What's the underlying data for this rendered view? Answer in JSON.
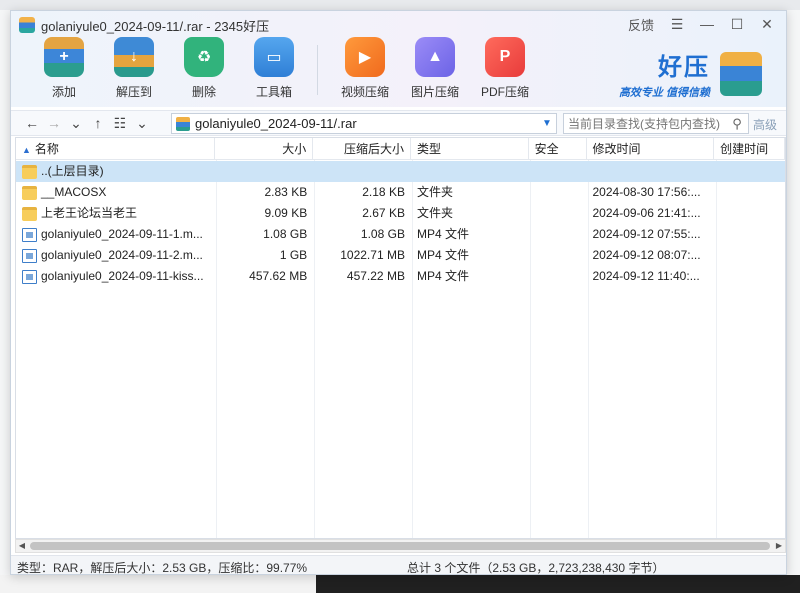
{
  "window": {
    "title": "golaniyule0_2024-09-11/.rar - 2345好压",
    "feedback_label": "反馈",
    "menu_glyph": "☰",
    "minimize_glyph": "—",
    "maximize_glyph": "☐",
    "close_glyph": "✕"
  },
  "toolbar": {
    "items": [
      {
        "label": "添加",
        "icon": "add-archive-icon"
      },
      {
        "label": "解压到",
        "icon": "extract-icon"
      },
      {
        "label": "删除",
        "icon": "recycle-delete-icon"
      },
      {
        "label": "工具箱",
        "icon": "toolbox-icon"
      },
      {
        "label": "视频压缩",
        "icon": "video-compress-icon"
      },
      {
        "label": "图片压缩",
        "icon": "image-compress-icon"
      },
      {
        "label": "PDF压缩",
        "icon": "pdf-compress-icon"
      }
    ]
  },
  "brand": {
    "name": "好压",
    "slogan": "高效专业  值得信赖"
  },
  "address": {
    "path": "golaniyule0_2024-09-11/.rar",
    "search_placeholder": "当前目录查找(支持包内查找)",
    "advanced_label": "高级"
  },
  "table": {
    "headers": [
      "名称",
      "大小",
      "压缩后大小",
      "类型",
      "安全",
      "修改时间",
      "创建时间"
    ],
    "rows": [
      {
        "name": "..(上层目录)",
        "size": "",
        "packed": "",
        "type": "",
        "security": "",
        "modified": "",
        "created": "",
        "kind": "folder",
        "selected": true
      },
      {
        "name": "__MACOSX",
        "size": "2.83 KB",
        "packed": "2.18 KB",
        "type": "文件夹",
        "security": "",
        "modified": "2024-08-30 17:56:...",
        "created": "",
        "kind": "folder",
        "selected": false
      },
      {
        "name": "上老王论坛当老王",
        "size": "9.09 KB",
        "packed": "2.67 KB",
        "type": "文件夹",
        "security": "",
        "modified": "2024-09-06 21:41:...",
        "created": "",
        "kind": "folder",
        "selected": false
      },
      {
        "name": "golaniyule0_2024-09-11-1.m...",
        "size": "1.08 GB",
        "packed": "1.08 GB",
        "type": "MP4 文件",
        "security": "",
        "modified": "2024-09-12 07:55:...",
        "created": "",
        "kind": "file",
        "selected": false
      },
      {
        "name": "golaniyule0_2024-09-11-2.m...",
        "size": "1 GB",
        "packed": "1022.71 MB",
        "type": "MP4 文件",
        "security": "",
        "modified": "2024-09-12 08:07:...",
        "created": "",
        "kind": "file",
        "selected": false
      },
      {
        "name": "golaniyule0_2024-09-11-kiss...",
        "size": "457.62 MB",
        "packed": "457.22 MB",
        "type": "MP4 文件",
        "security": "",
        "modified": "2024-09-12 11:40:...",
        "created": "",
        "kind": "file",
        "selected": false
      }
    ]
  },
  "status": {
    "left": "类型：RAR，解压后大小：2.53 GB，压缩比：99.77%",
    "right": "总计 3 个文件（2.53 GB，2,723,238,430 字节）"
  }
}
